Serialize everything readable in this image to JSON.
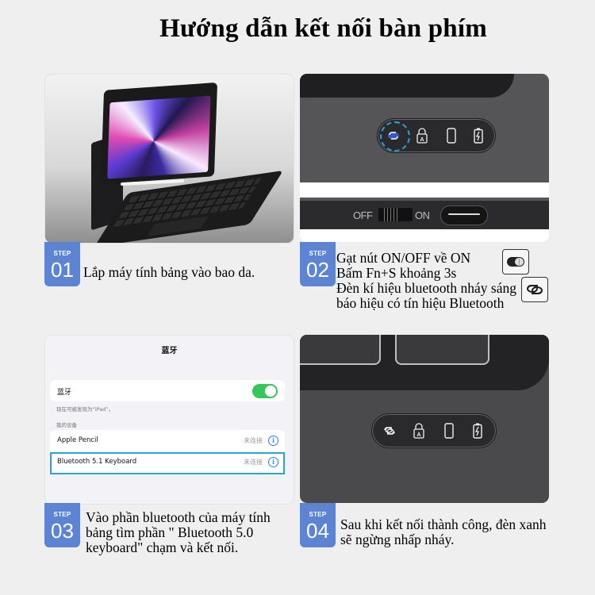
{
  "title": "Hướng dẫn kết nối bàn phím",
  "accent_color": "#5d84d3",
  "steps": [
    {
      "label": "STEP",
      "number": "01",
      "text": "Lắp máy tính bảng vào bao da."
    },
    {
      "label": "STEP",
      "number": "02",
      "lines": [
        "Gạt nút ON/OFF về ON",
        "Bấm Fn+S khoảng 3s",
        "Đèn kí hiệu bluetooth nháy sáng",
        "báo hiệu có tín hiệu Bluetooth"
      ],
      "switch": {
        "off_label": "OFF",
        "on_label": "ON"
      },
      "indicator_icons": [
        "bluetooth-pair-icon",
        "caps-lock-icon",
        "phone-icon",
        "battery-charging-icon"
      ],
      "legend_icons": [
        "toggle-switch-icon",
        "link-icon"
      ]
    },
    {
      "label": "STEP",
      "number": "03",
      "lines": [
        "Vào phần bluetooth của máy tính",
        "bảng tìm phần \" Bluetooth 5.0",
        "keyboard\" chạm và kết nối."
      ],
      "settings": {
        "title": "蓝牙",
        "bluetooth_label": "蓝牙",
        "bluetooth_on": true,
        "discoverable_note": "现在可被发现为“iPad”。",
        "section_header": "我的设备",
        "devices": [
          {
            "name": "Apple Pencil",
            "status": "未连接"
          },
          {
            "name": "Bluetooth 5.1 Keyboard",
            "status": "未连接",
            "highlighted": true
          }
        ]
      }
    },
    {
      "label": "STEP",
      "number": "04",
      "lines": [
        "Sau khi kết nối thành công, đèn xanh",
        "sẽ ngừng nhấp nháy."
      ],
      "indicator_icons": [
        "link-icon",
        "caps-lock-icon",
        "phone-icon",
        "battery-charging-icon"
      ]
    }
  ]
}
